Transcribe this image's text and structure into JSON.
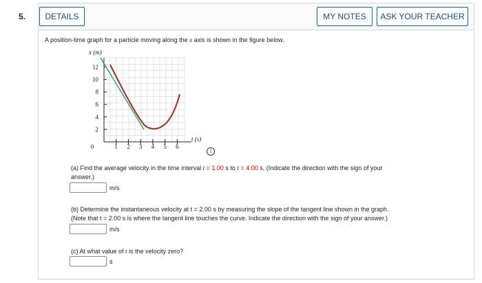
{
  "question": {
    "number": "5.",
    "details_label": "DETAILS",
    "my_notes_label": "MY NOTES",
    "ask_teacher_label": "ASK YOUR TEACHER",
    "prompt": {
      "before": "A position-time graph for a particle moving along the ",
      "var": "x",
      "after": " axis is shown in the figure below."
    }
  },
  "graph": {
    "y_axis_label": "x (m)",
    "x_axis_label": "t (s)",
    "y_ticks": [
      "12",
      "10",
      "8",
      "6",
      "4",
      "2"
    ],
    "x_ticks": [
      "0",
      "1",
      "2",
      "3",
      "4",
      "5",
      "6"
    ],
    "curve_color": "#a03a2a",
    "tangent_color": "#2aa58a",
    "info_icon": "info-icon"
  },
  "part_a": {
    "text1": "(a) Find the average velocity in the time interval ",
    "t_var1": "t",
    "eq1": " = ",
    "t1": "1.00",
    "mid": " s to ",
    "t_var2": "t",
    "eq2": " = ",
    "t2": "4.00",
    "text2": " s. (Indicate the direction with the sign of your",
    "text3": "answer.)",
    "unit": "m/s"
  },
  "part_b": {
    "line1": "(b) Determine the instantaneous velocity at t = 2.00 s by measuring the slope of the tangent line shown in the graph.",
    "line2": "(Note that t = 2.00 s is where the tangent line touches the curve. Indicate the direction with the sign of your answer.)",
    "unit": "m/s"
  },
  "part_c": {
    "before": "(c) At what value of ",
    "var": "t",
    "after": " is the velocity zero?",
    "unit": "s"
  }
}
